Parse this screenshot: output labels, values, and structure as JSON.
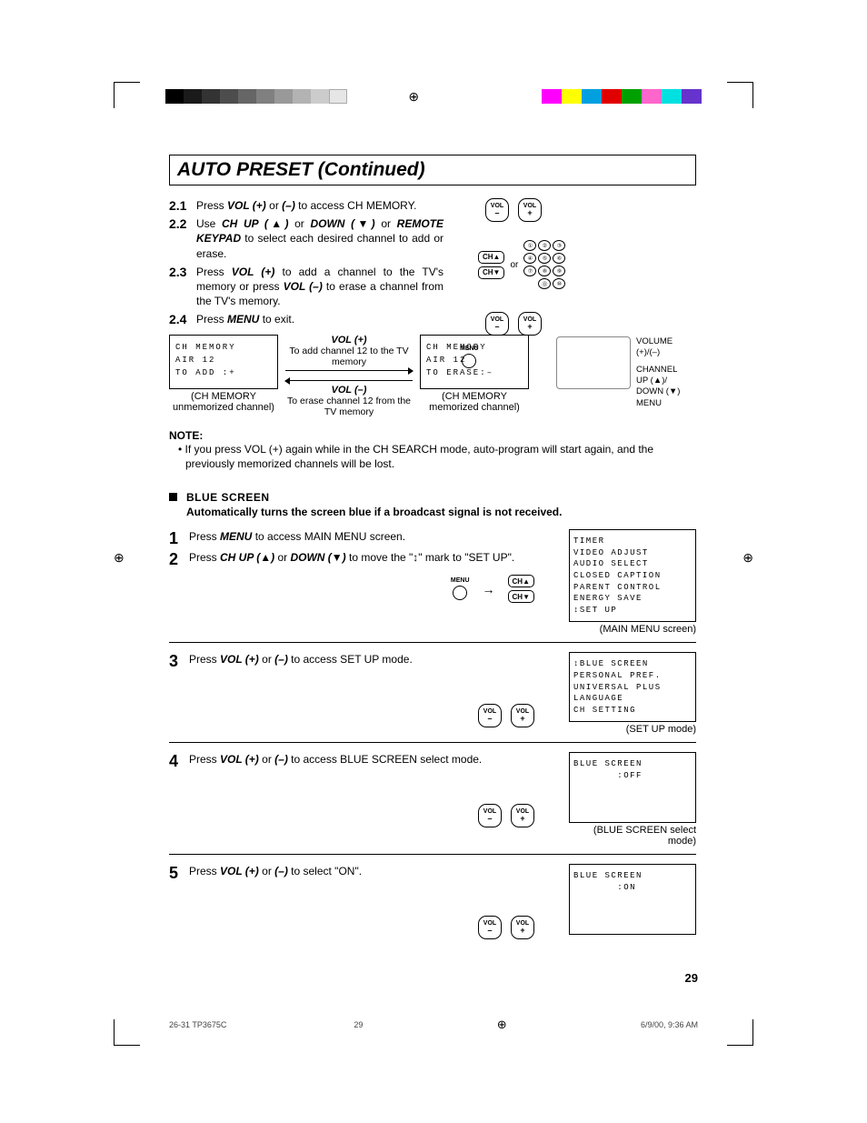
{
  "title": "AUTO PRESET (Continued)",
  "steps_top": {
    "s21_num": "2.1",
    "s21": "Press VOL (+) or (–) to access CH MEMORY.",
    "s22_num": "2.2",
    "s22": "Use CH UP (▲) or DOWN (▼) or REMOTE KEYPAD to select each desired channel to add or erase.",
    "s23_num": "2.3",
    "s23": "Press VOL (+) to add a channel to the TV's memory or press VOL (–) to erase a channel from the TV's memory.",
    "s24_num": "2.4",
    "s24": "Press MENU to exit."
  },
  "vol_buttons": {
    "vol": "VOL",
    "minus": "–",
    "plus": "+",
    "ch_up": "CH▲",
    "ch_dn": "CH▼",
    "or": "or",
    "menu": "MENU",
    "arrow": "→"
  },
  "keypad": [
    "1",
    "2",
    "3",
    "4",
    "5",
    "6",
    "7",
    "8",
    "9",
    "",
    "0",
    "100"
  ],
  "diagram": {
    "box_left_l1": "CH MEMORY",
    "box_left_l2": "AIR 12",
    "box_left_l3": "TO ADD  :+",
    "box_left_cap1": "(CH MEMORY",
    "box_left_cap2": "unmemorized channel)",
    "vol_plus": "VOL (+)",
    "vol_plus_desc": "To add channel 12 to the TV memory",
    "vol_minus": "VOL (–)",
    "vol_minus_desc": "To erase channel 12 from the TV memory",
    "box_right_l1": "CH MEMORY",
    "box_right_l2": "AIR 12",
    "box_right_l3": "TO ERASE:–",
    "box_right_cap1": "(CH MEMORY",
    "box_right_cap2": "memorized channel)"
  },
  "remote_side": {
    "volume": "VOLUME",
    "vol_pm": "(+)/(–)",
    "channel": "CHANNEL",
    "ch_up": "UP (▲)/",
    "ch_dn": "DOWN (▼)",
    "menu": "MENU"
  },
  "note": {
    "head": "NOTE:",
    "body": "• If you press VOL (+) again while in the CH SEARCH mode, auto-program will start again, and the previously memorized channels will be lost."
  },
  "blue": {
    "title": "BLUE SCREEN",
    "desc": "Automatically turns the screen blue if a broadcast signal is not received.",
    "s1": "Press MENU to access MAIN MENU screen.",
    "s2": "Press CH UP (▲) or DOWN (▼) to move the \"↕\" mark to \"SET UP\".",
    "s3": "Press VOL (+) or (–) to access SET UP mode.",
    "s4": "Press VOL (+) or (–) to access BLUE SCREEN select mode.",
    "s5": "Press VOL (+) or (–) to select \"ON\".",
    "n1": "1",
    "n2": "2",
    "n3": "3",
    "n4": "4",
    "n5": "5"
  },
  "panels": {
    "main_menu": [
      "TIMER",
      "VIDEO ADJUST",
      "AUDIO SELECT",
      "CLOSED CAPTION",
      "PARENT CONTROL",
      "ENERGY SAVE",
      "↕SET UP"
    ],
    "main_menu_cap": "(MAIN MENU screen)",
    "setup": [
      "↕BLUE SCREEN",
      "PERSONAL PREF.",
      "UNIVERSAL PLUS",
      "LANGUAGE",
      "CH SETTING"
    ],
    "setup_cap": "(SET UP mode)",
    "bs_off": [
      "BLUE SCREEN",
      "       :OFF"
    ],
    "bs_off_cap": "(BLUE SCREEN select mode)",
    "bs_on": [
      "BLUE SCREEN",
      "       :ON"
    ]
  },
  "pagenum": "29",
  "footer": {
    "left": "26-31 TP3675C",
    "mid": "29",
    "right": "6/9/00, 9:36 AM"
  }
}
